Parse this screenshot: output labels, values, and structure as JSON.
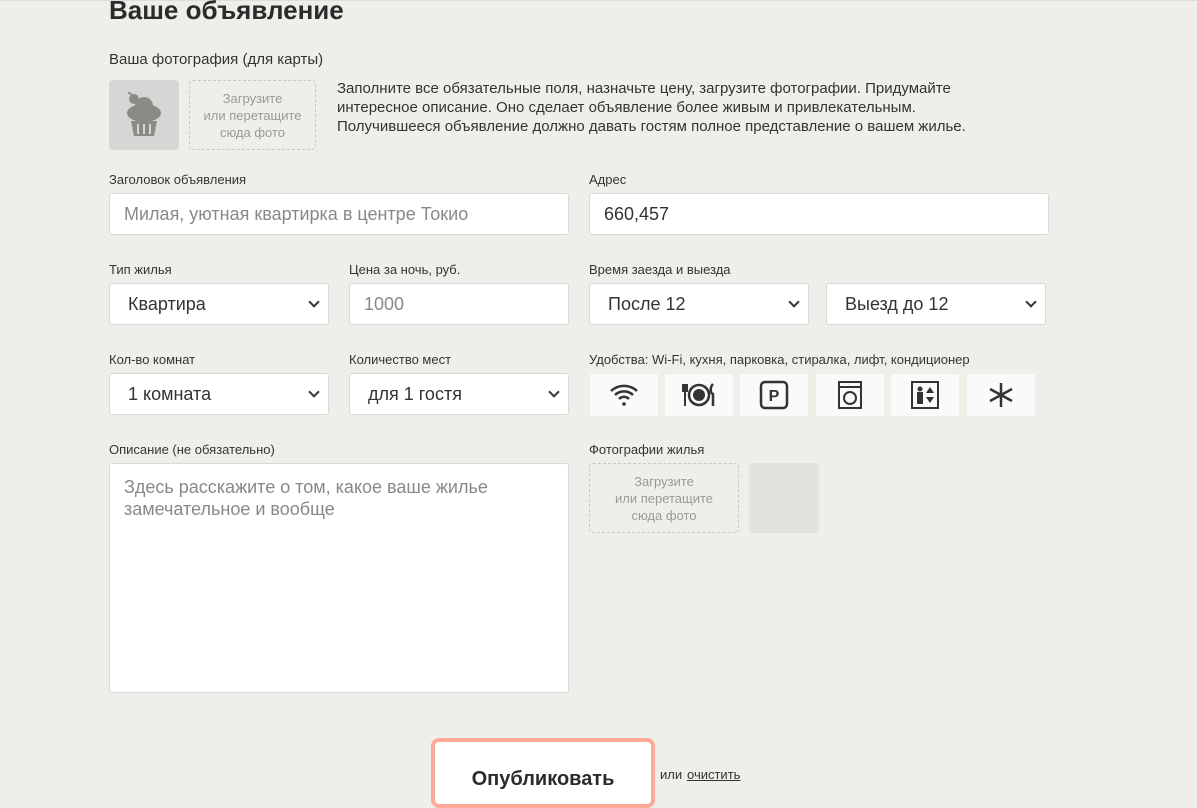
{
  "title": "Ваше объявление",
  "avatar": {
    "label": "Ваша фотография (для карты)",
    "drop": [
      "Загрузите",
      "или перетащите",
      "сюда фото"
    ],
    "hint": [
      "Заполните все обязательные поля, назначьте цену, загрузите фотографии. Придумайте",
      "интересное описание. Оно сделает объявление более живым и привлекательным.",
      "Получившееся объявление должно давать гостям полное представление о вашем жилье."
    ]
  },
  "fields": {
    "title": {
      "label": "Заголовок объявления",
      "placeholder": "Милая, уютная квартирка в центре Токио"
    },
    "address": {
      "label": "Адрес",
      "value": "660,457"
    },
    "type": {
      "label": "Тип жилья",
      "value": "Квартира"
    },
    "price": {
      "label": "Цена за ночь, руб.",
      "placeholder": "1000"
    },
    "time": {
      "label": "Время заезда и выезда",
      "checkin": "После 12",
      "checkout": "Выезд до 12"
    },
    "rooms": {
      "label": "Кол-во комнат",
      "value": "1 комната"
    },
    "capacity": {
      "label": "Количество мест",
      "value": "для 1 гостя"
    },
    "features": {
      "label": "Удобства: Wi-Fi, кухня, парковка, стиралка, лифт, кондиционер",
      "items": [
        "wifi-icon",
        "kitchen-icon",
        "parking-icon",
        "washer-icon",
        "elevator-icon",
        "conditioner-icon"
      ]
    },
    "description": {
      "label": "Описание (не обязательно)",
      "placeholder": "Здесь расскажите о том, какое ваше жилье замечательное и вообще"
    },
    "photos": {
      "label": "Фотографии жилья",
      "drop": [
        "Загрузите",
        "или перетащите",
        "сюда фото"
      ]
    }
  },
  "actions": {
    "submit": "Опубликовать",
    "or": "или",
    "reset": "очистить"
  },
  "colors": {
    "background": "#efefea",
    "submit_border": "#ffaa99"
  }
}
